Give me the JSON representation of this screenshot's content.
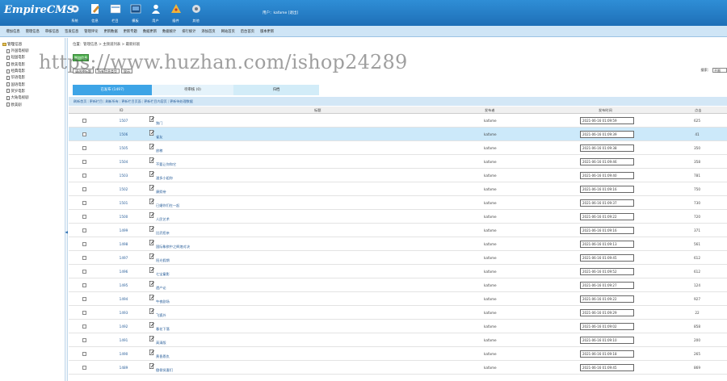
{
  "header": {
    "logo": "EmpireCMS",
    "logo_sub": "",
    "buttons": [
      {
        "label": "系统",
        "icon": "gear-icon"
      },
      {
        "label": "信息",
        "icon": "pencil-icon"
      },
      {
        "label": "栏目",
        "icon": "folder-icon"
      },
      {
        "label": "模板",
        "icon": "template-icon"
      },
      {
        "label": "用户",
        "icon": "user-icon"
      },
      {
        "label": "插件",
        "icon": "plugin-icon"
      },
      {
        "label": "其他",
        "icon": "cog-icon"
      }
    ],
    "userinfo": "用户：kafame  [退出]"
  },
  "nav": [
    "增加信息",
    "管理信息",
    "审核信息",
    "签发信息",
    "管理评论",
    "更新数据",
    "更新专题",
    "数据更新",
    "数据统计",
    "排行统计",
    "添加首页",
    "网站首页",
    "后台首页",
    "版本更新"
  ],
  "sidebar": {
    "root": "管理信息",
    "items": [
      "外国电视剧",
      "短国电影",
      "欧美电影",
      "经典电影",
      "华语电影",
      "国语电影",
      "贺岁电影",
      "大陆电视剧",
      "欧美剧"
    ]
  },
  "main": {
    "breadcrumb": "位置：管理信息 > 主频道列表 > 最新好剧",
    "add_button": "增加信息",
    "filter_select1": "请选择标题",
    "filter_select2": "所有信息类型",
    "filter_button": "显示",
    "search_label": "搜索：",
    "search_select": "不限",
    "tabs": [
      "已发布 (1497)",
      "待审核 (0)",
      "归档"
    ],
    "subnav": [
      "刷新首页",
      "更新栏目",
      "刷新所有",
      "更新栏目页面",
      "更新栏目内容页",
      "更新待处理数据"
    ],
    "columns": {
      "id": "ID",
      "title": "标题",
      "author": "发布者",
      "time": "发布时间",
      "hits": "点击"
    }
  },
  "table": {
    "rows": [
      {
        "id": "1507",
        "title": "独门",
        "author": "kafame",
        "time": "2021-06-16 01:09:59",
        "hits": "625",
        "highlight": false
      },
      {
        "id": "1506",
        "title": "雀友",
        "author": "kafame",
        "time": "2021-06-16 01:09:39",
        "hits": "41",
        "highlight": true
      },
      {
        "id": "1505",
        "title": "放粮",
        "author": "kafame",
        "time": "2021-06-16 01:09:38",
        "hits": "350",
        "highlight": false
      },
      {
        "id": "1504",
        "title": "不要让你和它",
        "author": "kafame",
        "time": "2021-06-16 01:09:46",
        "hits": "358",
        "highlight": false
      },
      {
        "id": "1503",
        "title": "潘多小姐你",
        "author": "kafame",
        "time": "2021-06-16 01:09:40",
        "hits": "781",
        "highlight": false
      },
      {
        "id": "1502",
        "title": "康熙帝",
        "author": "kafame",
        "time": "2021-06-16 01:09:16",
        "hits": "750",
        "highlight": false
      },
      {
        "id": "1501",
        "title": "已婚你们在一起",
        "author": "kafame",
        "time": "2021-06-16 01:09:37",
        "hits": "730",
        "highlight": false
      },
      {
        "id": "1500",
        "title": "人民艺术",
        "author": "kafame",
        "time": "2021-06-16 01:09:22",
        "hits": "720",
        "highlight": false
      },
      {
        "id": "1499",
        "title": "比武招亲",
        "author": "kafame",
        "time": "2021-06-16 01:09:16",
        "hits": "371",
        "highlight": false
      },
      {
        "id": "1498",
        "title": "国际象棋中之辉煌对决",
        "author": "kafame",
        "time": "2021-06-16 01:09:13",
        "hits": "561",
        "highlight": false
      },
      {
        "id": "1497",
        "title": "阳光假期",
        "author": "kafame",
        "time": "2021-06-16 01:09:45",
        "hits": "612",
        "highlight": false
      },
      {
        "id": "1496",
        "title": "七宝童影",
        "author": "kafame",
        "time": "2021-06-16 01:09:52",
        "hits": "612",
        "highlight": false
      },
      {
        "id": "1495",
        "title": "遗产论",
        "author": "kafame",
        "time": "2021-06-16 01:09:27",
        "hits": "124",
        "highlight": false
      },
      {
        "id": "1494",
        "title": "午夜剧场",
        "author": "kafame",
        "time": "2021-06-16 01:09:22",
        "hits": "927",
        "highlight": false
      },
      {
        "id": "1493",
        "title": "飞狐外",
        "author": "kafame",
        "time": "2021-06-16 01:09:29",
        "hits": "22",
        "highlight": false
      },
      {
        "id": "1492",
        "title": "春花下落",
        "author": "kafame",
        "time": "2021-06-16 01:09:02",
        "hits": "858",
        "highlight": false
      },
      {
        "id": "1491",
        "title": "高清版",
        "author": "kafame",
        "time": "2021-06-16 01:09:10",
        "hits": "200",
        "highlight": false
      },
      {
        "id": "1490",
        "title": "黄昏恩仇",
        "author": "kafame",
        "time": "2021-06-16 01:09:18",
        "hits": "265",
        "highlight": false
      },
      {
        "id": "1489",
        "title": "傲骨贤妻们",
        "author": "kafame",
        "time": "2021-06-16 01:09:45",
        "hits": "869",
        "highlight": false
      }
    ]
  },
  "watermark": "https://www.huzhan.com/ishop24289",
  "colors": {
    "header": "#2f8ed6",
    "tab_active": "#3da4e6",
    "row_highlight": "#cce9fa",
    "add_button": "#4cae4c"
  }
}
